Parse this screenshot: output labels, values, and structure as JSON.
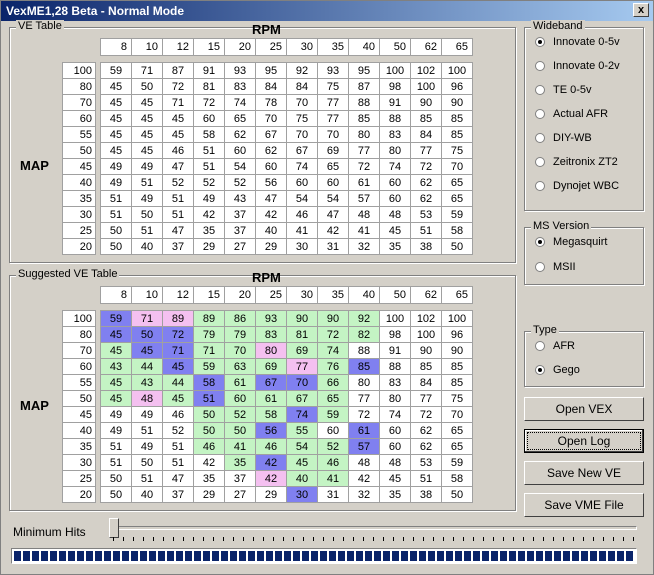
{
  "window": {
    "title": "VexME1,28 Beta - Normal Mode",
    "close_glyph": "x"
  },
  "ve_table": {
    "title": "VE Table",
    "rpm_label": "RPM",
    "map_label": "MAP",
    "rpm": [
      "8",
      "10",
      "12",
      "15",
      "20",
      "25",
      "30",
      "35",
      "40",
      "50",
      "62",
      "65"
    ],
    "map": [
      "100",
      "80",
      "70",
      "60",
      "55",
      "50",
      "45",
      "40",
      "35",
      "30",
      "25",
      "20"
    ],
    "rows": [
      [
        "59",
        "71",
        "87",
        "91",
        "93",
        "95",
        "92",
        "93",
        "95",
        "100",
        "102",
        "100"
      ],
      [
        "45",
        "50",
        "72",
        "81",
        "83",
        "84",
        "84",
        "75",
        "87",
        "98",
        "100",
        "96"
      ],
      [
        "45",
        "45",
        "71",
        "72",
        "74",
        "78",
        "70",
        "77",
        "88",
        "91",
        "90",
        "90"
      ],
      [
        "45",
        "45",
        "45",
        "60",
        "65",
        "70",
        "75",
        "77",
        "85",
        "88",
        "85",
        "85"
      ],
      [
        "45",
        "45",
        "45",
        "58",
        "62",
        "67",
        "70",
        "70",
        "80",
        "83",
        "84",
        "85"
      ],
      [
        "45",
        "45",
        "46",
        "51",
        "60",
        "62",
        "67",
        "69",
        "77",
        "80",
        "77",
        "75"
      ],
      [
        "49",
        "49",
        "47",
        "51",
        "54",
        "60",
        "74",
        "65",
        "72",
        "74",
        "72",
        "70"
      ],
      [
        "49",
        "51",
        "52",
        "52",
        "52",
        "56",
        "60",
        "60",
        "61",
        "60",
        "62",
        "65"
      ],
      [
        "51",
        "49",
        "51",
        "49",
        "43",
        "47",
        "54",
        "54",
        "57",
        "60",
        "62",
        "65"
      ],
      [
        "51",
        "50",
        "51",
        "42",
        "37",
        "42",
        "46",
        "47",
        "48",
        "48",
        "53",
        "59"
      ],
      [
        "50",
        "51",
        "47",
        "35",
        "37",
        "40",
        "41",
        "42",
        "41",
        "45",
        "51",
        "58"
      ],
      [
        "50",
        "40",
        "37",
        "29",
        "27",
        "29",
        "30",
        "31",
        "32",
        "35",
        "38",
        "50"
      ]
    ]
  },
  "suggested_table": {
    "title": "Suggested VE Table",
    "rpm_label": "RPM",
    "map_label": "MAP",
    "rpm": [
      "8",
      "10",
      "12",
      "15",
      "20",
      "25",
      "30",
      "35",
      "40",
      "50",
      "62",
      "65"
    ],
    "map": [
      "100",
      "80",
      "70",
      "60",
      "55",
      "50",
      "45",
      "40",
      "35",
      "30",
      "25",
      "20"
    ],
    "rows": [
      [
        "59",
        "71",
        "89",
        "89",
        "86",
        "93",
        "90",
        "90",
        "92",
        "100",
        "102",
        "100"
      ],
      [
        "45",
        "50",
        "72",
        "79",
        "79",
        "83",
        "81",
        "72",
        "82",
        "98",
        "100",
        "96"
      ],
      [
        "45",
        "45",
        "71",
        "71",
        "70",
        "80",
        "69",
        "74",
        "88",
        "91",
        "90",
        "90"
      ],
      [
        "43",
        "44",
        "45",
        "59",
        "63",
        "69",
        "77",
        "76",
        "85",
        "88",
        "85",
        "85"
      ],
      [
        "45",
        "43",
        "44",
        "58",
        "61",
        "67",
        "70",
        "66",
        "80",
        "83",
        "84",
        "85"
      ],
      [
        "45",
        "48",
        "45",
        "51",
        "60",
        "61",
        "67",
        "65",
        "77",
        "80",
        "77",
        "75"
      ],
      [
        "49",
        "49",
        "46",
        "50",
        "52",
        "58",
        "74",
        "59",
        "72",
        "74",
        "72",
        "70"
      ],
      [
        "49",
        "51",
        "52",
        "50",
        "50",
        "56",
        "55",
        "60",
        "61",
        "60",
        "62",
        "65"
      ],
      [
        "51",
        "49",
        "51",
        "46",
        "41",
        "46",
        "54",
        "52",
        "57",
        "60",
        "62",
        "65"
      ],
      [
        "51",
        "50",
        "51",
        "42",
        "35",
        "42",
        "45",
        "46",
        "48",
        "48",
        "53",
        "59"
      ],
      [
        "50",
        "51",
        "47",
        "35",
        "37",
        "42",
        "40",
        "41",
        "42",
        "45",
        "51",
        "58"
      ],
      [
        "50",
        "40",
        "37",
        "29",
        "27",
        "29",
        "30",
        "31",
        "32",
        "35",
        "38",
        "50"
      ]
    ],
    "colors": [
      [
        "b",
        "p",
        "p",
        "g",
        "g",
        "g",
        "g",
        "g",
        "g",
        "",
        "",
        ""
      ],
      [
        "b",
        "b",
        "b",
        "g",
        "g",
        "g",
        "g",
        "g",
        "g",
        "",
        "",
        ""
      ],
      [
        "g",
        "b",
        "b",
        "g",
        "g",
        "p",
        "g",
        "g",
        "",
        "",
        "",
        ""
      ],
      [
        "g",
        "g",
        "b",
        "g",
        "g",
        "g",
        "p",
        "g",
        "b",
        "",
        "",
        ""
      ],
      [
        "g",
        "g",
        "g",
        "b",
        "g",
        "b",
        "b",
        "g",
        "",
        "",
        "",
        ""
      ],
      [
        "g",
        "p",
        "g",
        "b",
        "g",
        "g",
        "g",
        "g",
        "",
        "",
        "",
        ""
      ],
      [
        "",
        "",
        "",
        "g",
        "g",
        "g",
        "b",
        "g",
        "",
        "",
        "",
        ""
      ],
      [
        "",
        "",
        "",
        "g",
        "g",
        "b",
        "g",
        "",
        "b",
        "",
        "",
        ""
      ],
      [
        "",
        "",
        "",
        "g",
        "g",
        "g",
        "g",
        "g",
        "b",
        "",
        "",
        ""
      ],
      [
        "",
        "",
        "",
        "",
        "g",
        "b",
        "g",
        "g",
        "",
        "",
        "",
        ""
      ],
      [
        "",
        "",
        "",
        "",
        "",
        "p",
        "g",
        "g",
        "",
        "",
        "",
        ""
      ],
      [
        "",
        "",
        "",
        "",
        "",
        "",
        "b",
        "",
        "",
        "",
        "",
        ""
      ]
    ]
  },
  "wideband": {
    "title": "Wideband",
    "options": [
      "Innovate 0-5v",
      "Innovate 0-2v",
      "TE 0-5v",
      "Actual AFR",
      "DIY-WB",
      "Zeitronix ZT2",
      "Dynojet WBC"
    ],
    "selected": 0
  },
  "ms_version": {
    "title": "MS Version",
    "options": [
      "Megasquirt",
      "MSII"
    ],
    "selected": 0
  },
  "type_group": {
    "title": "Type",
    "options": [
      "AFR",
      "Gego"
    ],
    "selected": 1
  },
  "buttons": {
    "open_vex": "Open VEX",
    "open_log": "Open Log",
    "save_new_ve": "Save New VE",
    "save_vme": "Save VME File"
  },
  "min_hits": {
    "label": "Minimum Hits",
    "value": 0
  },
  "progress": {
    "percent": 100
  }
}
